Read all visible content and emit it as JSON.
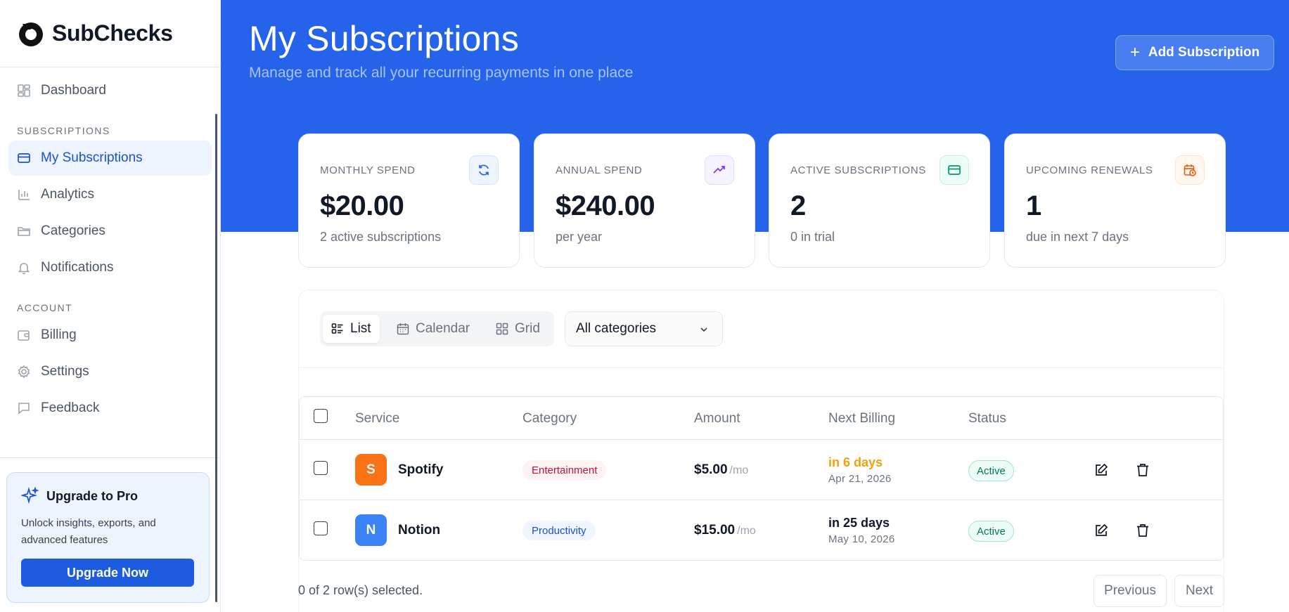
{
  "app": {
    "name": "SubChecks"
  },
  "sidebar": {
    "dashboard": {
      "label": "Dashboard",
      "icon": "dashboard-icon"
    },
    "sections": [
      {
        "label": "SUBSCRIPTIONS"
      },
      {
        "label": "ACCOUNT"
      }
    ],
    "items": [
      {
        "label": "My Subscriptions",
        "icon": "card-icon",
        "active": true
      },
      {
        "label": "Analytics",
        "icon": "bar-chart-icon"
      },
      {
        "label": "Categories",
        "icon": "folder-icon"
      },
      {
        "label": "Notifications",
        "icon": "bell-icon"
      },
      {
        "label": "Billing",
        "icon": "wallet-icon"
      },
      {
        "label": "Settings",
        "icon": "gear-icon"
      },
      {
        "label": "Feedback",
        "icon": "message-icon"
      }
    ],
    "upgrade": {
      "title": "Upgrade to Pro",
      "description": "Unlock insights, exports, and advanced features",
      "button": "Upgrade Now"
    }
  },
  "header": {
    "title": "My Subscriptions",
    "subtitle": "Manage and track all your recurring payments in one place",
    "add_button": "Add Subscription"
  },
  "stats": [
    {
      "label": "MONTHLY SPEND",
      "value": "$20.00",
      "sub": "2 active subscriptions",
      "icon": "refresh-icon",
      "color": "#2563eb"
    },
    {
      "label": "ANNUAL SPEND",
      "value": "$240.00",
      "sub": "per year",
      "icon": "trending-up-icon",
      "color": "#7c3aed"
    },
    {
      "label": "ACTIVE SUBSCRIPTIONS",
      "value": "2",
      "sub": "0 in trial",
      "icon": "card-icon",
      "color": "#059669"
    },
    {
      "label": "UPCOMING RENEWALS",
      "value": "1",
      "sub": "due in next 7 days",
      "icon": "calendar-clock-icon",
      "color": "#ea580c"
    }
  ],
  "toolbar": {
    "views": [
      {
        "label": "List",
        "icon": "list-icon",
        "active": true
      },
      {
        "label": "Calendar",
        "icon": "calendar-icon"
      },
      {
        "label": "Grid",
        "icon": "grid-icon"
      }
    ],
    "category_select": {
      "value": "All categories"
    }
  },
  "table": {
    "columns": [
      "Service",
      "Category",
      "Amount",
      "Next Billing",
      "Status"
    ],
    "rows": [
      {
        "initial": "S",
        "name": "Spotify",
        "badge_color": "#f97316",
        "category": "Entertainment",
        "category_bg": "#fef2f2",
        "category_color": "#be123c",
        "amount": "$5.00",
        "period": "/mo",
        "due": "in 6 days",
        "due_color": "#f59e0b",
        "date": "Apr 21, 2026",
        "status": "Active"
      },
      {
        "initial": "N",
        "name": "Notion",
        "badge_color": "#3b82f6",
        "category": "Productivity",
        "category_bg": "#eff6ff",
        "category_color": "#1d4ed8",
        "amount": "$15.00",
        "period": "/mo",
        "due": "in 25 days",
        "due_color": "#111827",
        "date": "May 10, 2026",
        "status": "Active"
      }
    ],
    "selection_text": "0 of 2 row(s) selected.",
    "pagination": {
      "previous": "Previous",
      "next": "Next"
    }
  }
}
